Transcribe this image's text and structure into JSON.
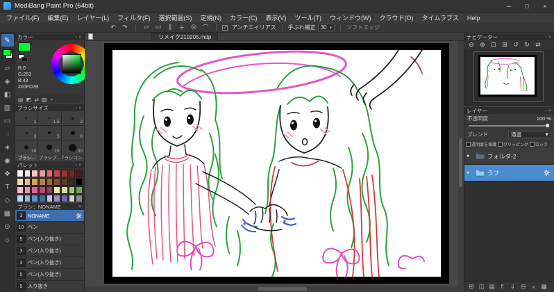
{
  "ui": {
    "collapse_glyph": "▫",
    "close_glyph": "×",
    "caret_glyph": "▾",
    "menu_glyph": "≡"
  },
  "window": {
    "title": "MediBang Paint Pro (64bit)",
    "minimize": "─",
    "maximize": "□",
    "close": "×"
  },
  "menubar": {
    "items": [
      "ファイル(F)",
      "編集(E)",
      "レイヤー(L)",
      "フィルタ(F)",
      "選択範囲(S)",
      "定規(N)",
      "カラー(C)",
      "表示(V)",
      "ツール(T)",
      "ウィンドウ(W)",
      "クラウド(O)",
      "タイムラプス",
      "Help"
    ]
  },
  "toolbar": {
    "history_icons": [
      {
        "name": "undo-icon",
        "glyph": "↶"
      },
      {
        "name": "redo-icon",
        "glyph": "↷"
      }
    ],
    "snap_icons": [
      {
        "name": "transform-icon",
        "glyph": "▱"
      },
      {
        "name": "snap-off-icon",
        "glyph": "▭"
      },
      {
        "name": "snap-parallel-icon",
        "glyph": "∥"
      },
      {
        "name": "snap-cross-icon",
        "glyph": "＋"
      },
      {
        "name": "snap-radial-icon",
        "glyph": "◎"
      },
      {
        "name": "snap-curve-icon",
        "glyph": "⌒"
      }
    ],
    "antialias_label": "アンチエイリアス",
    "antialias_checked": true,
    "stabilizer_label": "手ぶれ補正",
    "stabilizer_value": "30",
    "soft_edge_label": "ソフトエッジ"
  },
  "tools": {
    "foreground_color": "#00FD2B",
    "items": [
      {
        "name": "brush-tool",
        "glyph": "✎",
        "selected": true
      },
      {
        "name": "foreground-color-swatch",
        "swatch": true
      },
      {
        "name": "eraser-tool",
        "glyph": "▱"
      },
      {
        "name": "move-tool",
        "glyph": "◈"
      },
      {
        "name": "fill-tool",
        "glyph": "◧"
      },
      {
        "name": "gradient-tool",
        "glyph": "▥"
      },
      {
        "name": "select-tool",
        "glyph": "▭"
      },
      {
        "name": "lasso-tool",
        "glyph": "◌"
      },
      {
        "name": "magic-wand-tool",
        "glyph": "∗"
      },
      {
        "name": "eyedropper-tool",
        "glyph": "◉"
      },
      {
        "name": "hand-tool",
        "glyph": "❖"
      },
      {
        "name": "text-tool",
        "glyph": "T"
      },
      {
        "name": "shape-tool",
        "glyph": "◇"
      },
      {
        "name": "divide-tool",
        "glyph": "▦"
      },
      {
        "name": "zoom-tool",
        "glyph": "⊙"
      },
      {
        "name": "settings-tool",
        "glyph": "☼"
      }
    ]
  },
  "left_panels": {
    "color": {
      "title": "カラー",
      "r": "R:0",
      "g": "G:253",
      "b": "B:43",
      "hex": "#00FD2B"
    },
    "color_mini_icons": [
      {
        "name": "color-rgb-icon",
        "glyph": "▤"
      },
      {
        "name": "color-hsv-icon",
        "glyph": "◩"
      },
      {
        "name": "swap-colors-icon",
        "glyph": "⇄"
      },
      {
        "name": "transparent-color-icon",
        "glyph": "▨"
      },
      {
        "name": "color-history-icon",
        "glyph": "◔"
      }
    ],
    "brush_size": {
      "title": "ブラシサイズ",
      "sizes": [
        "1",
        "1.5",
        "2",
        "3",
        "5",
        "8",
        "10",
        "15",
        "30"
      ]
    },
    "panel_tabs": [
      "ブラシ...",
      "ブラシプ...",
      "ブラシコン..."
    ],
    "palette": {
      "title": "パレット",
      "colors": [
        "#ffffff",
        "#f6e3d7",
        "#f3c6c2",
        "#ea9a9a",
        "#dd6a6a",
        "#c74444",
        "#a42f2f",
        "#7c2222",
        "#521717",
        "#f7d9b8",
        "#edbb90",
        "#d79d68",
        "#bb8049",
        "#9c6536",
        "#7d4d27",
        "#5e3a1c",
        "#402812",
        "#000000",
        "#f4bccf",
        "#ec8fb4",
        "#dd6398",
        "#c04578",
        "#993763",
        "#f0e6b0",
        "#cde09a",
        "#9fc871",
        "#6faa4e",
        "#b9d9ea",
        "#8ab8d8",
        "#5d92c2",
        "#3f6ea6",
        "#c9bce2",
        "#9c8cc8",
        "#7264aa",
        "#cfcfcf",
        "#8a8a8a"
      ]
    },
    "brush_list": {
      "title": "ブラシ：NONAME",
      "items": [
        {
          "size": "3",
          "name": "NONAME",
          "selected": true
        },
        {
          "size": "10",
          "name": "ペン"
        },
        {
          "size": "5",
          "name": "ペン(入り抜き)"
        },
        {
          "size": "3",
          "name": "ペン(入り抜き)"
        },
        {
          "size": "3",
          "name": "ペン(入り抜き)"
        },
        {
          "size": "5",
          "name": "ペン(入り抜き)"
        },
        {
          "size": "5",
          "name": "入り抜き"
        }
      ]
    }
  },
  "canvas": {
    "tab": "リメイク210205.mdp"
  },
  "right_panels": {
    "navigator": {
      "title": "ナビゲーター",
      "icons": [
        {
          "name": "zoom-out-icon",
          "glyph": "⊖"
        },
        {
          "name": "zoom-in-icon",
          "glyph": "⊕"
        },
        {
          "name": "zoom-fit-icon",
          "glyph": "⊡"
        },
        {
          "name": "zoom-100-icon",
          "glyph": "⊞"
        },
        {
          "name": "rotate-ccw-icon",
          "glyph": "↺"
        },
        {
          "name": "rotate-cw-icon",
          "glyph": "↻"
        },
        {
          "name": "flip-view-icon",
          "glyph": "⇄"
        }
      ]
    },
    "layers": {
      "title": "レイヤー",
      "opacity_label": "不透明度",
      "opacity_value": "100 %",
      "blend_label": "ブレンド",
      "blend_value": "通過",
      "options": [
        "透明度を保護",
        "クリッピング",
        "ロック"
      ],
      "items": [
        {
          "name": "フォルダ-2",
          "selected": false
        },
        {
          "name": "ラフ",
          "selected": true
        }
      ],
      "bottom_icons": [
        {
          "name": "new-layer-icon",
          "glyph": "⊞"
        },
        {
          "name": "new-folder-icon",
          "glyph": "◫"
        },
        {
          "name": "duplicate-layer-icon",
          "glyph": "▤"
        },
        {
          "name": "move-layer-up-icon",
          "glyph": "⇑"
        },
        {
          "name": "move-layer-down-icon",
          "glyph": "⇓"
        },
        {
          "name": "merge-layer-icon",
          "glyph": "⊟"
        },
        {
          "name": "delete-layer-icon",
          "glyph": "×"
        },
        {
          "name": "layer-menu-icon",
          "glyph": "▦"
        }
      ]
    }
  }
}
